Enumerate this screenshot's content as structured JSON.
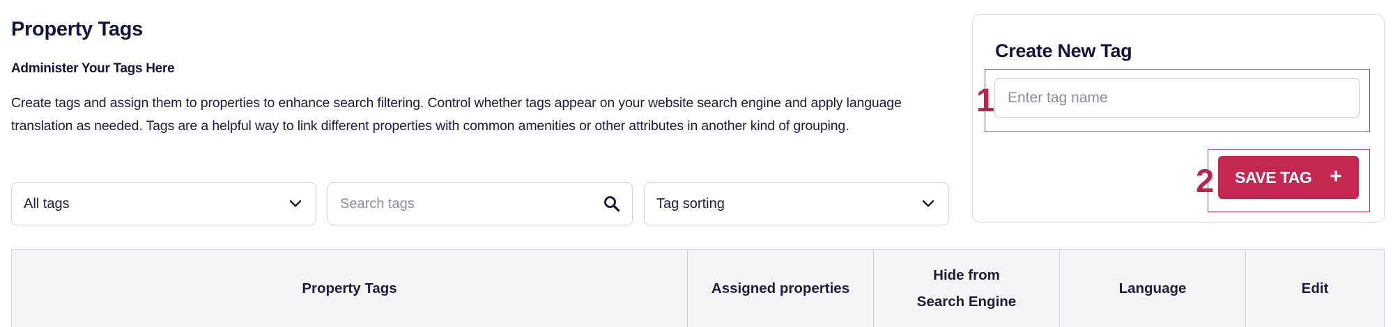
{
  "header": {
    "title": "Property Tags",
    "subtitle": "Administer Your Tags Here",
    "description": "Create tags and assign them to properties to enhance search filtering. Control whether tags appear on your website search engine and apply language translation as needed. Tags are a helpful way to link different properties with common amenities or other attributes in another kind of grouping."
  },
  "filters": {
    "tag_filter": {
      "selected": "All tags",
      "icon": "chevron-down-icon"
    },
    "search": {
      "placeholder": "Search tags",
      "value": "",
      "icon": "search-icon"
    },
    "sorting": {
      "selected": "Tag sorting",
      "icon": "chevron-down-icon"
    }
  },
  "create_panel": {
    "title": "Create New Tag",
    "input": {
      "placeholder": "Enter tag name",
      "value": ""
    },
    "save_button": {
      "label": "SAVE TAG",
      "icon_symbol": "+"
    }
  },
  "annotations": [
    {
      "number": "1",
      "target": "tag-name-input"
    },
    {
      "number": "2",
      "target": "save-tag-button"
    }
  ],
  "table": {
    "columns": [
      {
        "lines": [
          "Property Tags"
        ]
      },
      {
        "lines": [
          "Assigned properties"
        ]
      },
      {
        "lines": [
          "Hide from",
          "Search Engine"
        ]
      },
      {
        "lines": [
          "Language"
        ]
      },
      {
        "lines": [
          "Edit"
        ]
      }
    ]
  },
  "colors": {
    "accent": "#c4274f",
    "annotation": "#c4345a",
    "heading": "#13133b",
    "border": "#d4d4dc"
  }
}
